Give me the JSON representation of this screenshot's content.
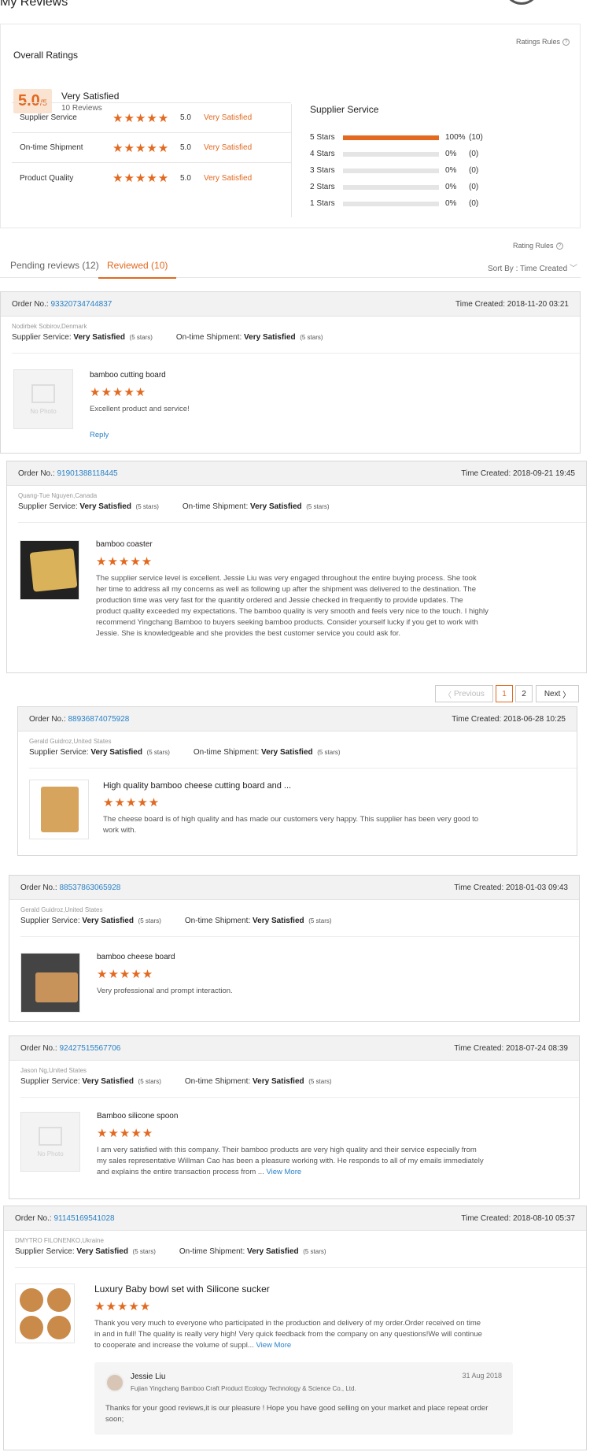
{
  "page": {
    "title": "My Reviews"
  },
  "ratings": {
    "rules_link": "Ratings Rules",
    "heading": "Overall Ratings",
    "score": "5.0",
    "score_suffix": "/5",
    "verdict": "Very Satisfied",
    "count": "10 Reviews",
    "rows": [
      {
        "label": "Supplier Service",
        "value": "5.0",
        "word": "Very Satisfied",
        "stars": 5
      },
      {
        "label": "On-time Shipment",
        "value": "5.0",
        "word": "Very Satisfied",
        "stars": 5
      },
      {
        "label": "Product Quality",
        "value": "5.0",
        "word": "Very Satisfied",
        "stars": 5
      }
    ],
    "dist_heading": "Supplier Service",
    "dist": [
      {
        "label": "5 Stars",
        "pct": "100%",
        "count": "(10)",
        "fraction": 1.0
      },
      {
        "label": "4 Stars",
        "pct": "0%",
        "count": "(0)",
        "fraction": 0
      },
      {
        "label": "3 Stars",
        "pct": "0%",
        "count": "(0)",
        "fraction": 0
      },
      {
        "label": "2 Stars",
        "pct": "0%",
        "count": "(0)",
        "fraction": 0
      },
      {
        "label": "1 Stars",
        "pct": "0%",
        "count": "(0)",
        "fraction": 0
      }
    ]
  },
  "rating_rules_link": "Rating Rules",
  "tabs": {
    "pending": "Pending reviews (12)",
    "reviewed": "Reviewed (10)",
    "sort": "Sort By : Time Created"
  },
  "labels": {
    "order_no": "Order No.:",
    "time_created": "Time Created:",
    "supplier_service": "Supplier Service:",
    "ontime_shipment": "On-time Shipment:",
    "very_satisfied": "Very Satisfied",
    "five_stars": "(5 stars)",
    "no_photo": "No Photo",
    "reply": "Reply",
    "view_more": "View More"
  },
  "pagination": {
    "previous": "Previous",
    "page1": "1",
    "page2": "2",
    "next": "Next"
  },
  "reviews": [
    {
      "order": "93320734744837",
      "time": "2018-11-20 03:21",
      "buyer": "Nodirbek Sobirov,Denmark",
      "product": "bamboo cutting board",
      "text": "Excellent product and service!"
    },
    {
      "order": "91901388118445",
      "time": "2018-09-21 19:45",
      "buyer": "Quang-Tue Nguyen,Canada",
      "product": "bamboo coaster",
      "text": "The supplier service level is excellent.  Jessie Liu was very engaged throughout the entire buying process.  She took her time to address all my concerns as well as following up after the shipment was delivered to the destination.  The production time was very fast for the quantity ordered and Jessie checked in frequently to provide updates.  The product quality exceeded my expectations.  The bamboo quality is very smooth and feels very nice to the touch.  I highly recommend Yingchang Bamboo to buyers seeking bamboo products.  Consider yourself lucky if you get to work with Jessie.  She is knowledgeable and she provides the best customer service you could ask for."
    },
    {
      "order": "88936874075928",
      "time": "2018-06-28 10:25",
      "buyer": "Gerald Guidroz,United States",
      "product": "High quality bamboo cheese cutting board and ...",
      "text": "The cheese board is of high quality and has made our customers very happy.  This supplier has been very good to work with."
    },
    {
      "order": "88537863065928",
      "time": "2018-01-03 09:43",
      "buyer": "Gerald Guidroz,United States",
      "product": "bamboo cheese board",
      "text": "Very professional and prompt interaction."
    },
    {
      "order": "92427515567706",
      "time": "2018-07-24 08:39",
      "buyer": "Jason Ng,United States",
      "product": "Bamboo silicone spoon",
      "text": "I am very satisfied with this company. Their bamboo products are very high quality and their service especially from my sales representative Willman Cao has been a pleasure working with. He responds to all of my emails immediately and explains the entire transaction process from ..."
    },
    {
      "order": "91145169541028",
      "time": "2018-08-10 05:37",
      "buyer": "DMYTRO FILONENKO,Ukraine",
      "product": "Luxury Baby bowl set with Silicone sucker",
      "text": "Thank you very much to everyone who participated in the production and delivery of my order.Order received on time in and in full! The quality is really very high! Very quick feedback from the company on any questions!We will continue to cooperate and increase the volume of suppl..."
    }
  ],
  "reply": {
    "name": "Jessie Liu",
    "date": "31 Aug 2018",
    "company": "Fujian Yingchang Bamboo Craft Product Ecology Technology & Science Co., Ltd.",
    "text": "Thanks for your good reviews,it is our pleasure ! Hope you have good selling on your market and place repeat order soon;"
  }
}
